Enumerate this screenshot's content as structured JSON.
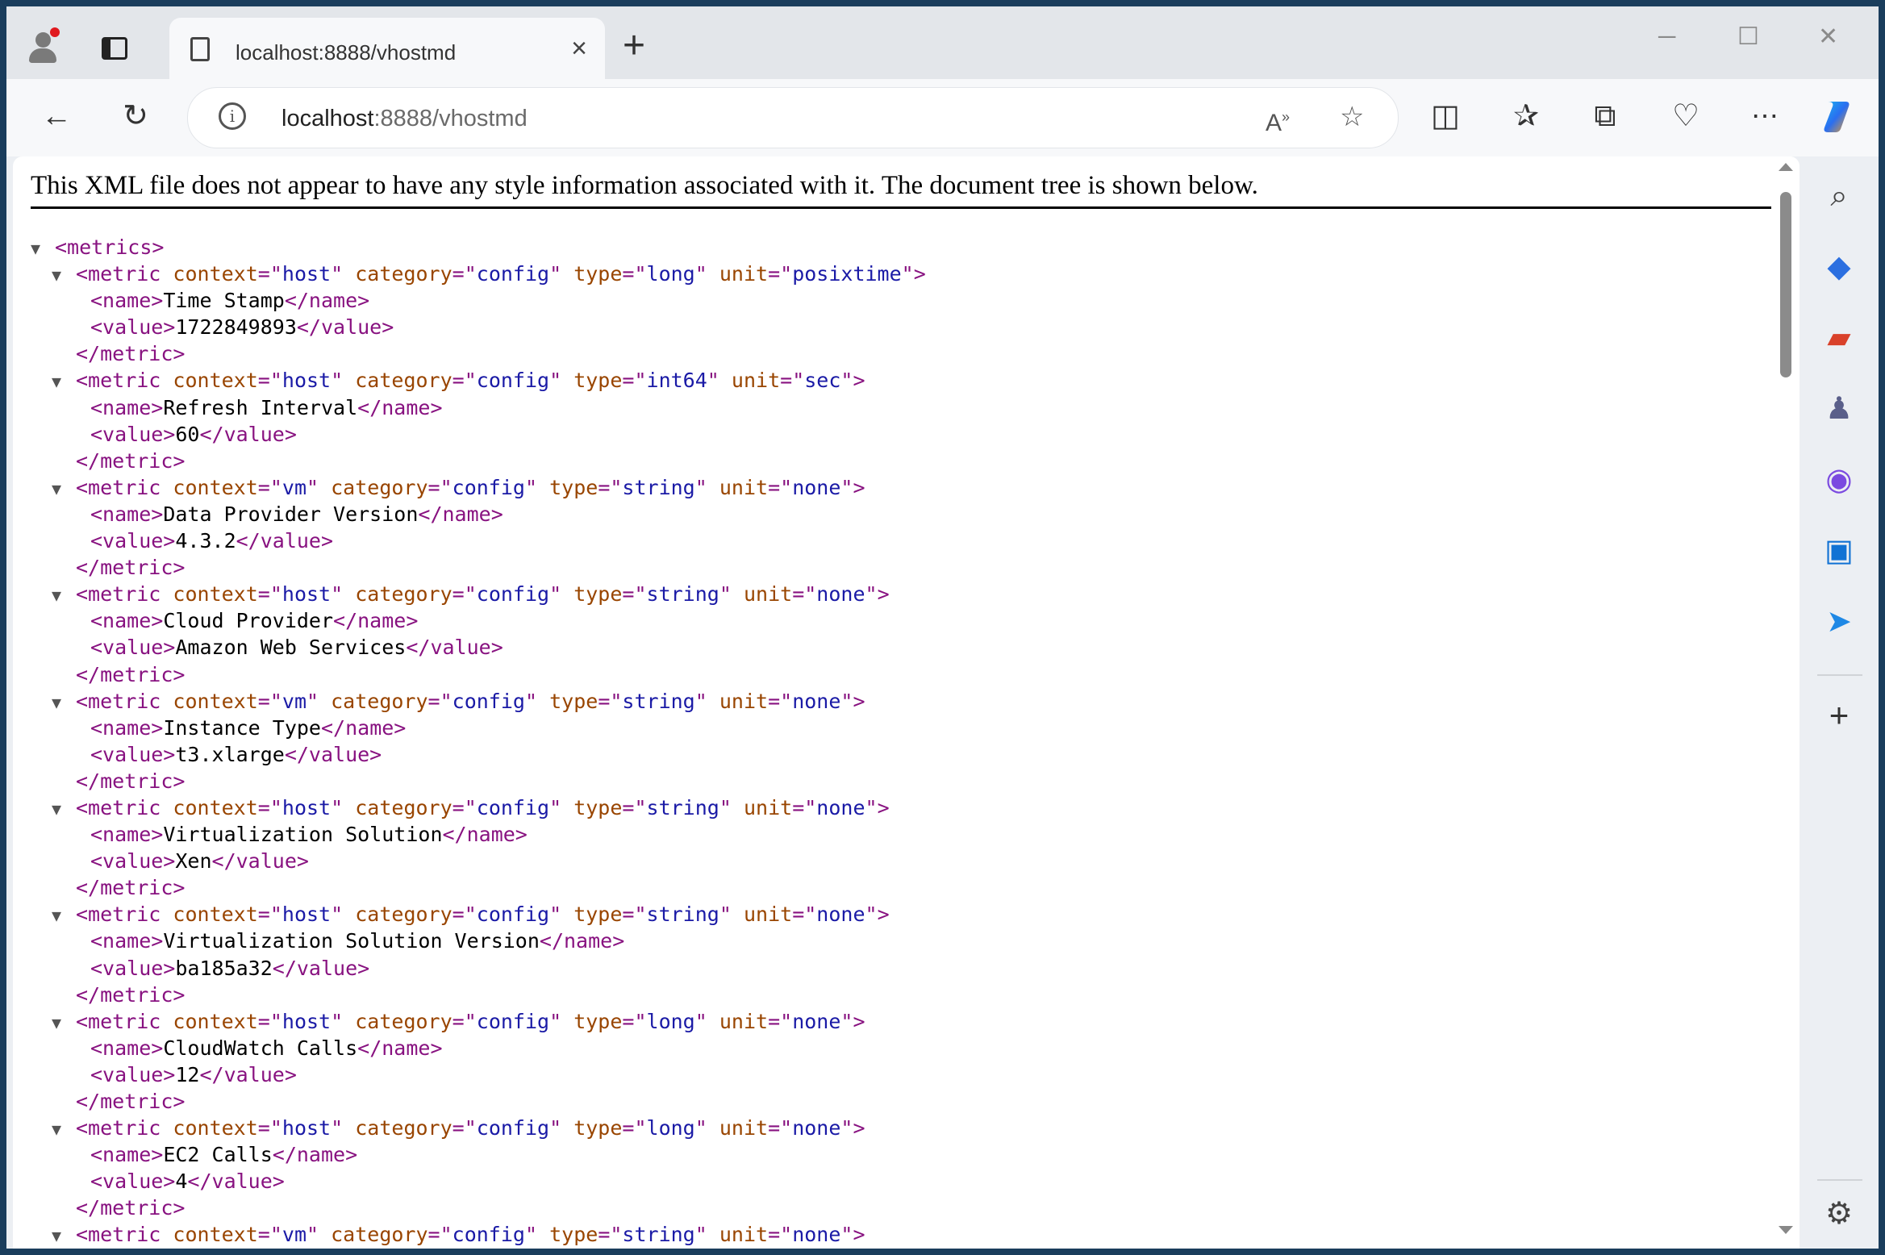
{
  "tab": {
    "title": "localhost:8888/vhostmd"
  },
  "window_controls": {
    "minimize": "─",
    "maximize": "☐",
    "close": "✕"
  },
  "toolbar": {
    "url_host": "localhost",
    "url_rest": ":8888/vhostmd"
  },
  "banner": "This XML file does not appear to have any style information associated with it. The document tree is shown below.",
  "colors": {
    "tag": "#881280",
    "attr_name": "#994500",
    "attr_value": "#1a1aa6"
  },
  "xml": {
    "root_open": "<metrics>",
    "metrics": [
      {
        "open": {
          "context": "host",
          "category": "config",
          "type": "long",
          "unit": "posixtime"
        },
        "name": "Time Stamp",
        "value": "1722849893"
      },
      {
        "open": {
          "context": "host",
          "category": "config",
          "type": "int64",
          "unit": "sec"
        },
        "name": "Refresh Interval",
        "value": "60"
      },
      {
        "open": {
          "context": "vm",
          "category": "config",
          "type": "string",
          "unit": "none"
        },
        "name": "Data Provider Version",
        "value": "4.3.2"
      },
      {
        "open": {
          "context": "host",
          "category": "config",
          "type": "string",
          "unit": "none"
        },
        "name": "Cloud Provider",
        "value": "Amazon Web Services"
      },
      {
        "open": {
          "context": "vm",
          "category": "config",
          "type": "string",
          "unit": "none"
        },
        "name": "Instance Type",
        "value": "t3.xlarge"
      },
      {
        "open": {
          "context": "host",
          "category": "config",
          "type": "string",
          "unit": "none"
        },
        "name": "Virtualization Solution",
        "value": "Xen"
      },
      {
        "open": {
          "context": "host",
          "category": "config",
          "type": "string",
          "unit": "none"
        },
        "name": "Virtualization Solution Version",
        "value": "ba185a32"
      },
      {
        "open": {
          "context": "host",
          "category": "config",
          "type": "long",
          "unit": "none"
        },
        "name": "CloudWatch Calls",
        "value": "12"
      },
      {
        "open": {
          "context": "host",
          "category": "config",
          "type": "long",
          "unit": "none"
        },
        "name": "EC2 Calls",
        "value": "4"
      },
      {
        "open": {
          "context": "vm",
          "category": "config",
          "type": "string",
          "unit": "none"
        }
      }
    ]
  },
  "icons": {
    "toolbar": [
      "back-icon",
      "refresh-icon",
      "read-aloud-icon",
      "favorite-star-icon",
      "split-screen-icon",
      "favorites-icon",
      "collections-icon",
      "browser-essentials-icon",
      "more-icon",
      "copilot-icon"
    ],
    "sidebar": [
      "search-icon",
      "shopping-tag-icon",
      "tools-icon",
      "games-icon",
      "microsoft365-icon",
      "outlook-icon",
      "send-icon",
      "add-icon",
      "settings-icon"
    ]
  }
}
